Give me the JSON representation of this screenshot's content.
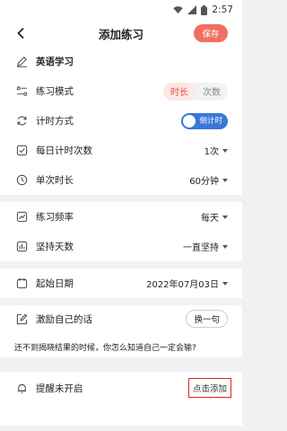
{
  "status": {
    "time": "2:57"
  },
  "header": {
    "title": "添加练习",
    "save_label": "保存"
  },
  "practice": {
    "name": "英语学习"
  },
  "mode": {
    "label": "练习模式",
    "options": [
      "时长",
      "次数"
    ],
    "selected": "时长"
  },
  "timing": {
    "label": "计时方式",
    "toggle_text": "倒计时"
  },
  "daily_count": {
    "label": "每日计时次数",
    "value": "1次"
  },
  "duration": {
    "label": "单次时长",
    "value": "60分钟"
  },
  "frequency": {
    "label": "练习频率",
    "value": "每天"
  },
  "persist": {
    "label": "坚持天数",
    "value": "一直坚持"
  },
  "start_date": {
    "label": "起始日期",
    "value": "2022年07月03日"
  },
  "motivation": {
    "label": "激励自己的话",
    "change_label": "换一句",
    "quote": "还不到揭晓结果的时候，你怎么知道自己一定会输?"
  },
  "reminder": {
    "label": "提醒未开启",
    "add_label": "点击添加"
  },
  "colors": {
    "accent": "#ef7061",
    "toggle": "#3a77d9",
    "highlight": "#e02020"
  }
}
